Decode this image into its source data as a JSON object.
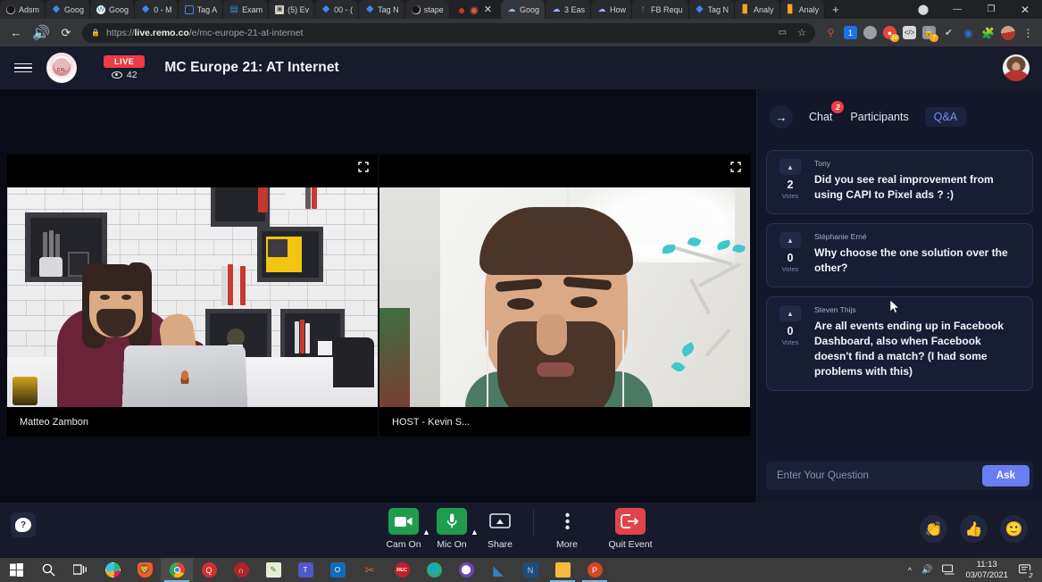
{
  "browser": {
    "tabs": [
      {
        "label": "Adsm",
        "icon": "github-icon"
      },
      {
        "label": "Goog",
        "icon": "google-drive-icon"
      },
      {
        "label": "Goog",
        "icon": "wordpress-icon"
      },
      {
        "label": "0 - M",
        "icon": "google-drive-icon"
      },
      {
        "label": "Tag A",
        "icon": "outline-square-icon"
      },
      {
        "label": "Exam",
        "icon": "teal-doc-icon"
      },
      {
        "label": "(5) Ev",
        "icon": "save-icon"
      },
      {
        "label": "00 - (",
        "icon": "google-drive-icon"
      },
      {
        "label": "Tag N",
        "icon": "google-drive-icon"
      },
      {
        "label": "stape",
        "icon": "github-icon"
      },
      {
        "label": "Goog",
        "icon": "cloud-icon"
      },
      {
        "label": "3 Eas",
        "icon": "cloud-icon"
      },
      {
        "label": "How",
        "icon": "cloud-icon"
      },
      {
        "label": "FB Requ",
        "icon": "facebook-icon"
      },
      {
        "label": "Tag N",
        "icon": "google-drive-icon"
      },
      {
        "label": "Analy",
        "icon": "analytics-icon"
      },
      {
        "label": "Analy",
        "icon": "analytics-icon"
      }
    ],
    "new_tab_label": "+",
    "close_tab_label": "✕",
    "window_controls": {
      "profile": "⬤",
      "minimize": "—",
      "maximize": "❐",
      "close": "✕"
    },
    "nav": {
      "back": "←",
      "forward_hidden": "",
      "reload": "⟳"
    },
    "omnibox": {
      "lock": "🔒",
      "url_prefix": "https://",
      "url_domain": "live.remo.co",
      "url_path": "/e/mc-europe-21-at-internet",
      "camera_icon": "video-icon",
      "bookmark_icon": "star-icon"
    },
    "extensions": [
      {
        "name": "tag-assistant-icon",
        "color": "#c0563a",
        "badge": "",
        "badge_color": ""
      },
      {
        "name": "blue-box-icon",
        "color": "#1a73e8",
        "badge": "",
        "badge_color": ""
      },
      {
        "name": "grey-circle-icon",
        "color": "#9aa0a6",
        "badge": "",
        "badge_color": ""
      },
      {
        "name": "notification-icon",
        "color": "#e8453c",
        "badge": "10",
        "badge_color": "#f5a623"
      },
      {
        "name": "code-icon",
        "color": "#d6d8da",
        "badge": "",
        "badge_color": ""
      },
      {
        "name": "lock-extension-icon",
        "color": "#8b93a1",
        "badge": "7",
        "badge_color": "#f5a623"
      },
      {
        "name": "checkmark-icon",
        "color": "#b9bdc3",
        "badge": "",
        "badge_color": ""
      },
      {
        "name": "blue-ring-icon",
        "color": "#2f6fd0",
        "badge": "",
        "badge_color": ""
      },
      {
        "name": "puzzle-icon",
        "color": "#d6d8da",
        "badge": "",
        "badge_color": ""
      },
      {
        "name": "profile-avatar",
        "color": "",
        "badge": "",
        "badge_color": ""
      },
      {
        "name": "chrome-menu-icon",
        "color": "#d6d8da",
        "badge": "",
        "badge_color": ""
      }
    ]
  },
  "app": {
    "menu_icon": "hamburger-icon",
    "brand": "CXL",
    "live_badge": "LIVE",
    "viewer_count": "42",
    "event_title": "MC Europe 21: AT Internet"
  },
  "stage": {
    "tiles": [
      {
        "name": "Matteo Zambon",
        "expand_icon": "expand-icon"
      },
      {
        "name": "HOST - Kevin S...",
        "expand_icon": "expand-icon"
      }
    ]
  },
  "controls": {
    "help_label": "?",
    "items": [
      {
        "label": "Cam On",
        "icon": "camera-icon",
        "state": "on",
        "has_caret": true
      },
      {
        "label": "Mic On",
        "icon": "microphone-icon",
        "state": "on",
        "has_caret": true
      },
      {
        "label": "Share",
        "icon": "screen-share-icon",
        "state": "off",
        "has_caret": false
      },
      {
        "label": "More",
        "icon": "more-dots-icon",
        "state": "off",
        "has_caret": false
      },
      {
        "label": "Quit Event",
        "icon": "exit-icon",
        "state": "quit",
        "has_caret": false
      }
    ],
    "reactions": [
      {
        "name": "clap-reaction",
        "glyph": "👏"
      },
      {
        "name": "thumbs-up-reaction",
        "glyph": "👍"
      },
      {
        "name": "smiley-reaction",
        "glyph": "🙂"
      }
    ]
  },
  "panel": {
    "collapse_icon": "→",
    "tabs": [
      {
        "label": "Chat",
        "badge": "2",
        "active": false
      },
      {
        "label": "Participants",
        "badge": "",
        "active": false
      },
      {
        "label": "Q&A",
        "badge": "",
        "active": true
      }
    ],
    "questions": [
      {
        "author": "Tony",
        "votes": "2",
        "votes_label": "Votes",
        "text": "Did you see real improvement from using CAPI to Pixel ads ? :)"
      },
      {
        "author": "Stéphanie Erné",
        "votes": "0",
        "votes_label": "Votes",
        "text": "Why choose the one solution over the other?"
      },
      {
        "author": "Steven Thijs",
        "votes": "0",
        "votes_label": "Votes",
        "text": "Are all events ending up in Facebook Dashboard, also when Facebook doesn't find a match? (I had some problems with this)"
      }
    ],
    "input": {
      "placeholder": "Enter Your Question",
      "value": "",
      "submit_label": "Ask"
    }
  },
  "taskbar": {
    "start_icon": "windows-start-icon",
    "search_icon": "search-icon",
    "taskview_icon": "task-view-icon",
    "apps": [
      {
        "name": "slack-icon",
        "color": "#e01e5a"
      },
      {
        "name": "brave-icon",
        "color": "#f25b2a"
      },
      {
        "name": "chrome-icon",
        "color": "#4285f4"
      },
      {
        "name": "acrobat-icon",
        "color": "#d32f2f"
      },
      {
        "name": "headphones-icon",
        "color": "#b0232a"
      },
      {
        "name": "notepad-icon",
        "color": "#3f8a3f"
      },
      {
        "name": "teams-icon",
        "color": "#5059c9"
      },
      {
        "name": "outlook-icon",
        "color": "#0f6cbd"
      },
      {
        "name": "scissors-icon",
        "color": "#e06a2b"
      },
      {
        "name": "recorder-icon",
        "color": "#c42026"
      },
      {
        "name": "globe-icon",
        "color": "#2faa6e"
      },
      {
        "name": "github-desktop-icon",
        "color": "#6f42c1"
      },
      {
        "name": "vscode-icon",
        "color": "#2f80c8"
      },
      {
        "name": "tag-manager-icon",
        "color": "#1f4e79"
      },
      {
        "name": "file-explorer-icon",
        "color": "#f6b93b"
      },
      {
        "name": "powerpoint-icon",
        "color": "#d24726"
      }
    ],
    "tray": {
      "expand_icon": "^",
      "volume_icon": "🔊",
      "network_icon": "network-icon",
      "time": "11:13",
      "date": "03/07/2021",
      "notifications_count": "2"
    }
  }
}
